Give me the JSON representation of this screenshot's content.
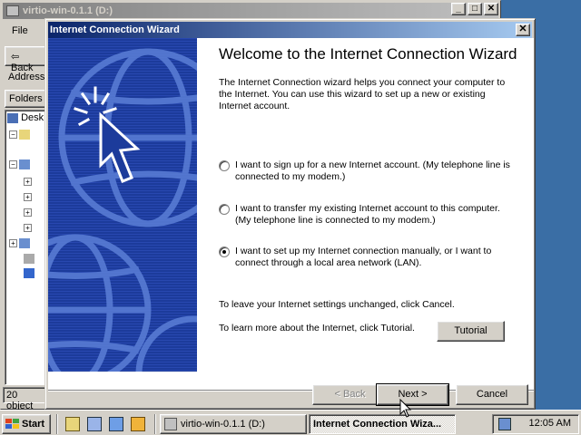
{
  "explorer": {
    "title": "virtio-win-0.1.1 (D:)",
    "menu_file": "File",
    "back_label": "Back",
    "address_label": "Address",
    "folders_label": "Folders",
    "tree_desktop": "Desk",
    "status": "20 object"
  },
  "wizard": {
    "title": "Internet Connection Wizard",
    "heading": "Welcome to the Internet Connection Wizard",
    "intro": "The Internet Connection wizard helps you connect your computer to the Internet.  You can use this wizard to set up a new or existing Internet account.",
    "options": [
      {
        "label": "I want to sign up for a new Internet account. (My telephone line is connected to my modem.)",
        "checked": false
      },
      {
        "label": "I want to transfer my existing Internet account to this computer. (My telephone line is connected to my modem.)",
        "checked": false
      },
      {
        "label": "I want to set up my Internet connection manually, or I want to connect through a local area network (LAN).",
        "checked": true
      }
    ],
    "leave_text": "To leave your Internet settings unchanged, click Cancel.",
    "learn_text": "To learn more about the Internet, click Tutorial.",
    "tutorial_label": "Tutorial",
    "back_label": "< Back",
    "next_label": "Next >",
    "cancel_label": "Cancel",
    "sidebar_color": "#1c3b9b"
  },
  "taskbar": {
    "start_label": "Start",
    "quick_launch": [
      "ie-icon",
      "desktop-icon",
      "outlook-icon",
      "media-icon"
    ],
    "tasks": [
      {
        "label": "virtio-win-0.1.1 (D:)",
        "active": false
      },
      {
        "label": "Internet Connection Wiza...",
        "active": true
      }
    ],
    "clock": "12:05 AM"
  }
}
